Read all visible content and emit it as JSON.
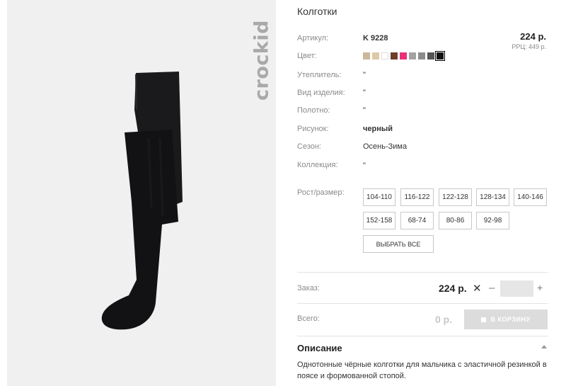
{
  "product": {
    "title": "Колготки",
    "brand_logo": "crockid",
    "price": "224 р.",
    "rrp": "РРЦ: 449 р."
  },
  "attributes": [
    {
      "label": "Артикул:",
      "value": "K 9228",
      "bold": true
    },
    {
      "label": "Цвет:",
      "value": "",
      "bold": false
    },
    {
      "label": "Утеплитель:",
      "value": "\"",
      "bold": false
    },
    {
      "label": "Вид изделия:",
      "value": "\"",
      "bold": false
    },
    {
      "label": "Полотно:",
      "value": "\"",
      "bold": false
    },
    {
      "label": "Рисунок:",
      "value": "черный",
      "bold": true
    },
    {
      "label": "Сезон:",
      "value": "Осень-Зима",
      "bold": false
    },
    {
      "label": "Коллекция:",
      "value": "\"",
      "bold": false
    }
  ],
  "colors": [
    "#cdb898",
    "#dcc9a8",
    "#ffffff",
    "#6b3f2a",
    "#e8307a",
    "#a3a3a3",
    "#8c8c8c",
    "#555555",
    "#111111"
  ],
  "selected_color_index": 8,
  "size_label": "Рост/размер:",
  "sizes": [
    "104-110",
    "116-122",
    "122-128",
    "128-134",
    "140-146",
    "152-158",
    "68-74",
    "80-86",
    "92-98"
  ],
  "select_all_label": "ВЫБРАТЬ ВСЕ",
  "order": {
    "label": "Заказ:",
    "price": "224 р.",
    "times": "✕",
    "minus": "–",
    "plus": "+",
    "quantity": ""
  },
  "total": {
    "label": "Всего:",
    "value": "0 р.",
    "cart_button": "В КОРЗИНУ"
  },
  "description": {
    "heading": "Описание",
    "text": "Однотонные чёрные колготки для мальчика с эластичной резинкой в поясе и формованной стопой."
  }
}
